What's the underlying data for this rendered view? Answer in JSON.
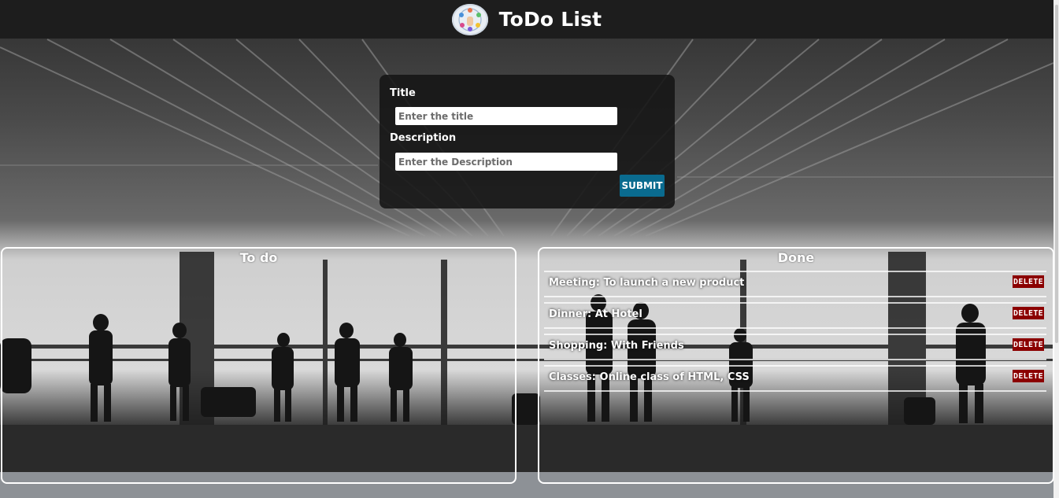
{
  "header": {
    "title": "ToDo List",
    "logo_icon": "people-network-logo"
  },
  "form": {
    "title_label": "Title",
    "title_placeholder": "Enter the title",
    "title_value": "",
    "description_label": "Description",
    "description_placeholder": "Enter the Description",
    "description_value": "",
    "submit_label": "SUBMIT"
  },
  "todo": {
    "heading": "To do",
    "items": []
  },
  "done": {
    "heading": "Done",
    "items": [
      {
        "text": "Meeting: To launch a new product",
        "delete_label": "DELETE"
      },
      {
        "text": "Dinner: At Hotel",
        "delete_label": "DELETE"
      },
      {
        "text": "Shopping: With Friends",
        "delete_label": "DELETE"
      },
      {
        "text": "Classes: Online class of HTML, CSS",
        "delete_label": "DELETE"
      }
    ]
  },
  "colors": {
    "header_bg": "#1d1d1d",
    "submit_bg": "#0a6b8f",
    "delete_bg": "#8b0000",
    "panel_border": "#ffffff"
  }
}
